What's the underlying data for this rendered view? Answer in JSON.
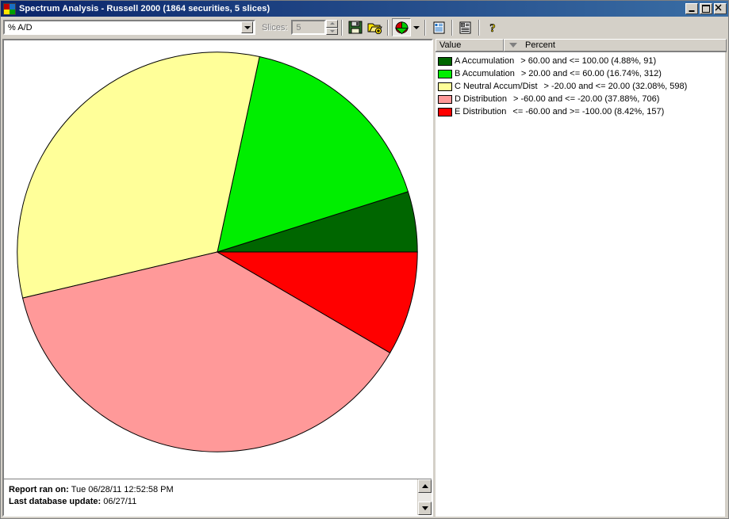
{
  "window": {
    "title": "Spectrum Analysis - Russell 2000 (1864 securities, 5 slices)",
    "app_icon": "pie-chart-app-icon",
    "minimize_label": "_",
    "maximize_label": "□",
    "close_label": "✕"
  },
  "toolbar": {
    "indicator_select": {
      "value": "% A/D",
      "icon": "chevron-down-icon"
    },
    "slices": {
      "label": "Slices:",
      "value": "5"
    },
    "buttons": [
      {
        "name": "save-button",
        "icon": "floppy-disk-icon",
        "pressed": false
      },
      {
        "name": "open-add-button",
        "icon": "open-folder-plus-icon",
        "pressed": false
      },
      {
        "name": "pie-chart-view-button",
        "icon": "pie-chart-icon",
        "pressed": true
      },
      {
        "name": "chart-type-dropdown-button",
        "icon": "chevron-down-icon",
        "pressed": false
      },
      {
        "name": "report-view-button",
        "icon": "list-report-icon",
        "pressed": false
      },
      {
        "name": "add-report-button",
        "icon": "list-plus-icon",
        "pressed": false
      },
      {
        "name": "help-button",
        "icon": "question-mark-icon",
        "pressed": false
      }
    ]
  },
  "legend": {
    "columns": [
      "Value",
      "Percent"
    ],
    "sort_indicator": "sort-descending-icon",
    "rows": [
      {
        "name": "A Accumulation",
        "range": "> 60.00 and <= 100.00 (4.88%, 91)",
        "color": "#006600"
      },
      {
        "name": "B Accumulation",
        "range": "> 20.00 and <= 60.00 (16.74%, 312)",
        "color": "#00ee00"
      },
      {
        "name": "C Neutral Accum/Dist",
        "range": "> -20.00 and <= 20.00 (32.08%, 598)",
        "color": "#ffff99"
      },
      {
        "name": "D Distribution",
        "range": "> -60.00 and <= -20.00 (37.88%, 706)",
        "color": "#ff9999"
      },
      {
        "name": "E Distribution",
        "range": "<= -60.00 and >= -100.00 (8.42%, 157)",
        "color": "#ff0000"
      }
    ]
  },
  "footer": {
    "report_ran_label": "Report ran on:",
    "report_ran_value": "Tue 06/28/11 12:52:58 PM",
    "last_update_label": "Last database update:",
    "last_update_value": "06/27/11"
  },
  "chart_data": {
    "type": "pie",
    "title": "Spectrum Analysis - Russell 2000",
    "subtitle": "1864 securities, 5 slices",
    "metric": "% A/D",
    "categories": [
      "A Accumulation",
      "B Accumulation",
      "C Neutral Accum/Dist",
      "D Distribution",
      "E Distribution"
    ],
    "values": [
      4.88,
      16.74,
      32.08,
      37.88,
      8.42
    ],
    "counts": [
      91,
      312,
      598,
      706,
      157
    ],
    "ranges": [
      "> 60.00 and <= 100.00",
      "> 20.00 and <= 60.00",
      "> -20.00 and <= 20.00",
      "> -60.00 and <= -20.00",
      "<= -60.00 and >= -100.00"
    ],
    "colors": [
      "#006600",
      "#00ee00",
      "#ffff99",
      "#ff9999",
      "#ff0000"
    ],
    "total_securities": 1864,
    "start_angle_deg": 0,
    "direction": "counterclockwise",
    "stroke": "#000000",
    "legend_position": "right",
    "xlabel": "",
    "ylabel": ""
  }
}
